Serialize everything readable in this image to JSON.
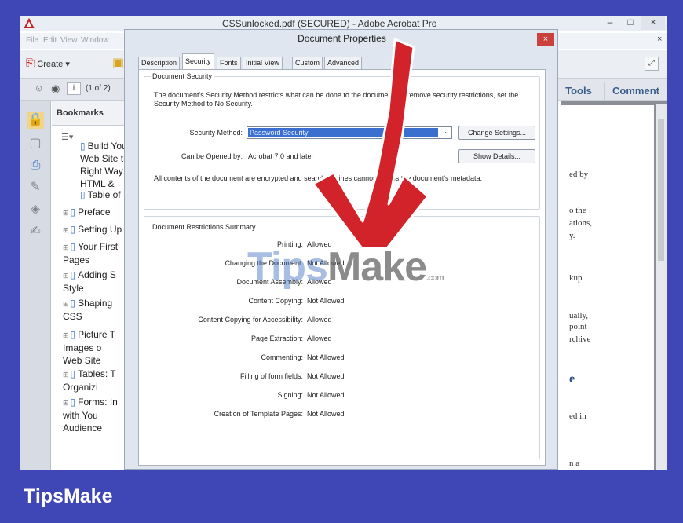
{
  "window": {
    "title": "CSSunlocked.pdf (SECURED) - Adobe Acrobat Pro",
    "min": "–",
    "max": "□",
    "close": "×"
  },
  "menu": [
    "File",
    "Edit",
    "View",
    "Window"
  ],
  "toolbar": {
    "create_label": "Create ▾",
    "page_indicator": "(1 of 2)",
    "page_number": "i",
    "tools_label": "Tools",
    "comment_label": "Comment"
  },
  "bookmarks": {
    "header": "Bookmarks",
    "items": [
      {
        "label": "Build Your\nWeb Site the\nRight Way\nHTML &",
        "expandable": false
      },
      {
        "label": "Table of",
        "expandable": false
      },
      {
        "label": "Preface",
        "expandable": true
      },
      {
        "label": "Setting Up",
        "expandable": true
      },
      {
        "label": "Your First\nPages",
        "expandable": true
      },
      {
        "label": "Adding S\nStyle",
        "expandable": true
      },
      {
        "label": "Shaping\nCSS",
        "expandable": true
      },
      {
        "label": "Picture T\nImages o\nWeb Site",
        "expandable": true
      },
      {
        "label": "Tables: T\nOrganizi",
        "expandable": true
      },
      {
        "label": "Forms: In\nwith You\nAudience",
        "expandable": true
      }
    ]
  },
  "doc_fragments": [
    "ed by",
    "o the",
    "ations,",
    "y.",
    "kup",
    "ually,",
    "point",
    "rchive",
    "e",
    "ed in",
    "n a"
  ],
  "dialog": {
    "title": "Document Properties",
    "close": "×",
    "tabs": [
      "Description",
      "Security",
      "Fonts",
      "Initial View",
      "Custom",
      "Advanced"
    ],
    "active_tab": "Security",
    "security": {
      "group_label": "Document Security",
      "description": "The document's Security Method restricts what can be done to the document. To remove security restrictions, set the Security Method to No Security.",
      "method_label": "Security Method:",
      "method_value": "Password Security",
      "change_settings": "Change Settings...",
      "opened_by_label": "Can be Opened by:",
      "opened_by_value": "Acrobat 7.0 and later",
      "show_details": "Show Details...",
      "encryption_note": "All contents of the document are encrypted and search engines cannot access the document's metadata."
    },
    "restrictions": {
      "group_label": "Document Restrictions Summary",
      "rows": [
        {
          "label": "Printing:",
          "value": "Allowed"
        },
        {
          "label": "Changing the Document:",
          "value": "Not Allowed"
        },
        {
          "label": "Document Assembly:",
          "value": "Allowed"
        },
        {
          "label": "Content Copying:",
          "value": "Not Allowed"
        },
        {
          "label": "Content Copying for Accessibility:",
          "value": "Allowed"
        },
        {
          "label": "Page Extraction:",
          "value": "Allowed"
        },
        {
          "label": "Commenting:",
          "value": "Not Allowed"
        },
        {
          "label": "Filling of form fields:",
          "value": "Not Allowed"
        },
        {
          "label": "Signing:",
          "value": "Not Allowed"
        },
        {
          "label": "Creation of Template Pages:",
          "value": "Not Allowed"
        }
      ]
    }
  },
  "watermark": {
    "brand_a": "Tips",
    "brand_b": "Make",
    "suffix": ".com"
  },
  "banner": "TipsMake",
  "colors": {
    "frame": "#3f46b6",
    "arrow": "#d2232a",
    "select": "#3a6fd0",
    "close": "#c9413a"
  }
}
